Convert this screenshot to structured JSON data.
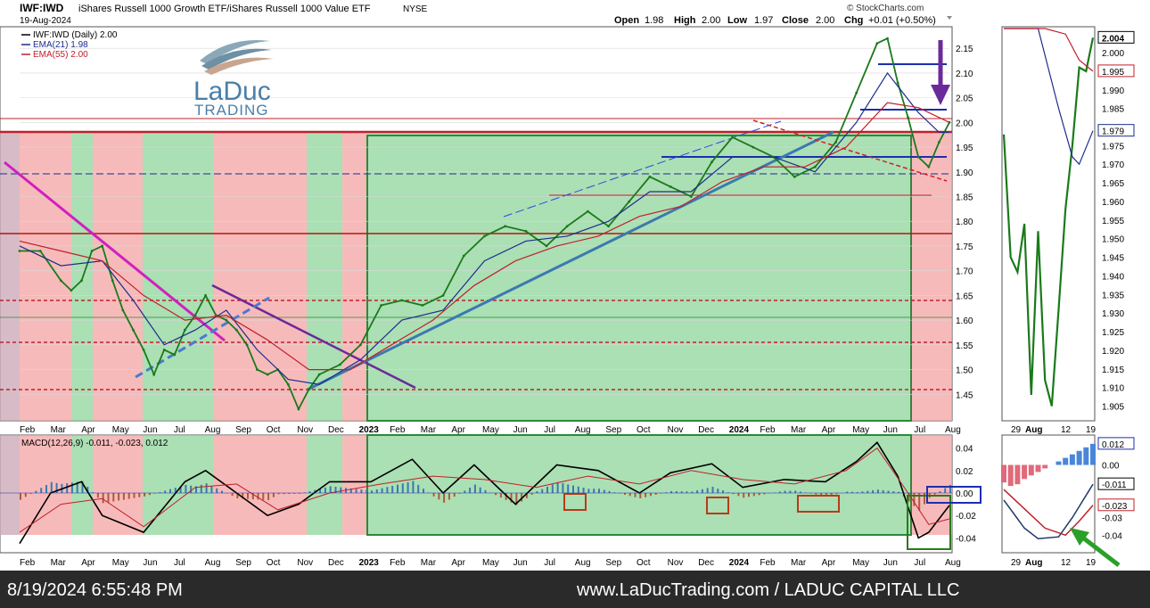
{
  "header": {
    "symbol": "IWF:IWD",
    "description": "iShares Russell 1000 Growth ETF/iShares Russell 1000 Value ETF",
    "exchange": "NYSE",
    "date": "19-Aug-2024",
    "watermark": "© StockCharts.com",
    "ohlc": {
      "open_label": "Open",
      "open": "1.98",
      "high_label": "High",
      "high": "2.00",
      "low_label": "Low",
      "low": "1.97",
      "close_label": "Close",
      "close": "2.00",
      "chg_label": "Chg",
      "chg": "+0.01 (+0.50%)"
    }
  },
  "legend": [
    {
      "text": "IWF:IWD (Daily) 2.00",
      "color": "#000000"
    },
    {
      "text": "EMA(21) 1.98",
      "color": "#1c2e8c"
    },
    {
      "text": "EMA(55) 2.00",
      "color": "#c0202a"
    }
  ],
  "logo": {
    "line1": "LaDuc",
    "line2": "TRADING"
  },
  "macd_label": "MACD(12,26,9) -0.011, -0.023, 0.012",
  "footer": {
    "timestamp": "8/19/2024 6:55:48 PM",
    "site": "www.LaDucTrading.com / LADUC CAPITAL LLC"
  },
  "colors": {
    "up": "#1a7a1a",
    "ema21": "#1c2e8c",
    "ema55": "#c0202a",
    "red_zone": "#f4a3a3",
    "green_zone": "#8fd49b",
    "magenta": "#d020c0",
    "purple": "#6a2a9a",
    "steelblue": "#3a7ab0",
    "green_arrow": "#2aa02a"
  },
  "chart_data": [
    {
      "type": "line",
      "title": "IWF:IWD (Daily) 2.00",
      "x_labels": [
        "Feb",
        "Mar",
        "Apr",
        "May",
        "Jun",
        "Jul",
        "Aug",
        "Sep",
        "Oct",
        "Nov",
        "Dec",
        "2023",
        "Feb",
        "Mar",
        "Apr",
        "May",
        "Jun",
        "Jul",
        "Aug",
        "Sep",
        "Oct",
        "Nov",
        "Dec",
        "2024",
        "Feb",
        "Mar",
        "Apr",
        "May",
        "Jun",
        "Jul",
        "Aug"
      ],
      "y_ticks": [
        "2.15",
        "2.10",
        "2.05",
        "2.00",
        "1.95",
        "1.90",
        "1.85",
        "1.80",
        "1.75",
        "1.70",
        "1.65",
        "1.60",
        "1.55",
        "1.50",
        "1.45"
      ],
      "ylim": [
        1.4,
        2.19
      ],
      "series": [
        {
          "name": "IWF:IWD (Daily) 2.00",
          "points": [
            [
              0,
              1.74
            ],
            [
              2,
              1.74
            ],
            [
              4,
              1.68
            ],
            [
              5,
              1.66
            ],
            [
              6,
              1.68
            ],
            [
              7,
              1.74
            ],
            [
              8,
              1.75
            ],
            [
              9,
              1.68
            ],
            [
              10,
              1.62
            ],
            [
              11,
              1.58
            ],
            [
              12,
              1.54
            ],
            [
              13,
              1.49
            ],
            [
              14,
              1.54
            ],
            [
              15,
              1.53
            ],
            [
              16,
              1.58
            ],
            [
              17,
              1.61
            ],
            [
              18,
              1.65
            ],
            [
              19,
              1.61
            ],
            [
              20,
              1.6
            ],
            [
              21,
              1.58
            ],
            [
              22,
              1.55
            ],
            [
              23,
              1.5
            ],
            [
              24,
              1.49
            ],
            [
              25,
              1.5
            ],
            [
              26,
              1.47
            ],
            [
              27,
              1.42
            ],
            [
              28,
              1.46
            ],
            [
              29,
              1.49
            ],
            [
              31,
              1.51
            ],
            [
              33,
              1.55
            ],
            [
              35,
              1.63
            ],
            [
              37,
              1.64
            ],
            [
              39,
              1.63
            ],
            [
              41,
              1.65
            ],
            [
              43,
              1.73
            ],
            [
              45,
              1.77
            ],
            [
              47,
              1.79
            ],
            [
              49,
              1.78
            ],
            [
              51,
              1.75
            ],
            [
              53,
              1.79
            ],
            [
              55,
              1.82
            ],
            [
              57,
              1.79
            ],
            [
              59,
              1.84
            ],
            [
              61,
              1.89
            ],
            [
              63,
              1.87
            ],
            [
              65,
              1.85
            ],
            [
              67,
              1.92
            ],
            [
              69,
              1.97
            ],
            [
              71,
              1.95
            ],
            [
              73,
              1.93
            ],
            [
              75,
              1.89
            ],
            [
              77,
              1.91
            ],
            [
              79,
              1.96
            ],
            [
              81,
              2.06
            ],
            [
              83,
              2.16
            ],
            [
              84,
              2.17
            ],
            [
              85,
              2.08
            ],
            [
              86,
              2.01
            ],
            [
              87,
              1.93
            ],
            [
              88,
              1.91
            ],
            [
              89,
              1.96
            ],
            [
              90,
              2.0
            ]
          ]
        },
        {
          "name": "EMA(21) 1.98",
          "points": [
            [
              0,
              1.75
            ],
            [
              4,
              1.71
            ],
            [
              8,
              1.72
            ],
            [
              11,
              1.64
            ],
            [
              14,
              1.55
            ],
            [
              17,
              1.58
            ],
            [
              20,
              1.62
            ],
            [
              23,
              1.54
            ],
            [
              26,
              1.48
            ],
            [
              29,
              1.47
            ],
            [
              33,
              1.52
            ],
            [
              37,
              1.6
            ],
            [
              41,
              1.62
            ],
            [
              45,
              1.72
            ],
            [
              49,
              1.76
            ],
            [
              53,
              1.77
            ],
            [
              57,
              1.8
            ],
            [
              61,
              1.86
            ],
            [
              65,
              1.86
            ],
            [
              69,
              1.93
            ],
            [
              73,
              1.93
            ],
            [
              77,
              1.9
            ],
            [
              81,
              2.0
            ],
            [
              84,
              2.1
            ],
            [
              87,
              2.02
            ],
            [
              89,
              1.98
            ],
            [
              90,
              1.98
            ]
          ]
        },
        {
          "name": "EMA(55) 2.00",
          "points": [
            [
              0,
              1.76
            ],
            [
              4,
              1.74
            ],
            [
              8,
              1.72
            ],
            [
              12,
              1.65
            ],
            [
              16,
              1.6
            ],
            [
              20,
              1.61
            ],
            [
              24,
              1.56
            ],
            [
              28,
              1.5
            ],
            [
              32,
              1.5
            ],
            [
              36,
              1.55
            ],
            [
              40,
              1.6
            ],
            [
              44,
              1.67
            ],
            [
              48,
              1.72
            ],
            [
              52,
              1.75
            ],
            [
              56,
              1.77
            ],
            [
              60,
              1.81
            ],
            [
              64,
              1.83
            ],
            [
              68,
              1.88
            ],
            [
              72,
              1.91
            ],
            [
              76,
              1.91
            ],
            [
              80,
              1.95
            ],
            [
              84,
              2.04
            ],
            [
              87,
              2.03
            ],
            [
              90,
              2.0
            ]
          ]
        }
      ]
    },
    {
      "type": "line",
      "title": "",
      "x_labels": [
        "29",
        "Aug",
        "12",
        "19"
      ],
      "y_ticks": [
        "2.004",
        "2.000",
        "1.995",
        "1.990",
        "1.985",
        "1.980",
        "1.979",
        "1.975",
        "1.970",
        "1.965",
        "1.960",
        "1.955",
        "1.950",
        "1.945",
        "1.940",
        "1.935",
        "1.930",
        "1.925",
        "1.920",
        "1.915",
        "1.910",
        "1.905"
      ],
      "ylim": [
        1.902,
        2.006
      ],
      "series": [
        {
          "name": "IWF:IWD",
          "points": [
            [
              0,
              1.978
            ],
            [
              1,
              1.945
            ],
            [
              2,
              1.941
            ],
            [
              3,
              1.954
            ],
            [
              4,
              1.908
            ],
            [
              5,
              1.952
            ],
            [
              6,
              1.912
            ],
            [
              7,
              1.905
            ],
            [
              8,
              1.931
            ],
            [
              9,
              1.958
            ],
            [
              10,
              1.975
            ],
            [
              11,
              1.996
            ],
            [
              12,
              1.995
            ],
            [
              13,
              2.004
            ]
          ]
        },
        {
          "name": "EMA(21)",
          "points": [
            [
              0,
              2.04
            ],
            [
              5,
              2.02
            ],
            [
              8,
              1.985
            ],
            [
              10,
              1.972
            ],
            [
              11,
              1.97
            ],
            [
              13,
              1.979
            ]
          ]
        },
        {
          "name": "EMA(55)",
          "points": [
            [
              0,
              2.02
            ],
            [
              6,
              2.015
            ],
            [
              9,
              2.005
            ],
            [
              11,
              1.998
            ],
            [
              13,
              1.995
            ]
          ]
        }
      ]
    },
    {
      "type": "line",
      "title": "MACD(12,26,9) -0.011, -0.023, 0.012",
      "y_ticks": [
        "0.04",
        "0.02",
        "0.00",
        "-0.02",
        "-0.04"
      ],
      "ylim": [
        -0.05,
        0.05
      ],
      "series": [
        {
          "name": "MACD",
          "points": [
            [
              0,
              -0.045
            ],
            [
              3,
              0.0
            ],
            [
              6,
              0.01
            ],
            [
              8,
              -0.02
            ],
            [
              12,
              -0.035
            ],
            [
              16,
              0.01
            ],
            [
              18,
              0.02
            ],
            [
              21,
              0.0
            ],
            [
              24,
              -0.02
            ],
            [
              27,
              -0.01
            ],
            [
              30,
              0.01
            ],
            [
              34,
              0.01
            ],
            [
              38,
              0.03
            ],
            [
              41,
              0.0
            ],
            [
              44,
              0.025
            ],
            [
              48,
              -0.01
            ],
            [
              52,
              0.025
            ],
            [
              56,
              0.02
            ],
            [
              60,
              0.0
            ],
            [
              63,
              0.018
            ],
            [
              67,
              0.026
            ],
            [
              70,
              0.005
            ],
            [
              74,
              0.012
            ],
            [
              78,
              0.01
            ],
            [
              81,
              0.028
            ],
            [
              83,
              0.045
            ],
            [
              85,
              0.015
            ],
            [
              87,
              -0.04
            ],
            [
              88,
              -0.035
            ],
            [
              90,
              -0.011
            ]
          ]
        },
        {
          "name": "Signal",
          "points": [
            [
              0,
              -0.035
            ],
            [
              4,
              -0.01
            ],
            [
              8,
              -0.005
            ],
            [
              12,
              -0.03
            ],
            [
              17,
              0.005
            ],
            [
              21,
              0.008
            ],
            [
              25,
              -0.015
            ],
            [
              30,
              0.0
            ],
            [
              35,
              0.008
            ],
            [
              40,
              0.015
            ],
            [
              45,
              0.012
            ],
            [
              50,
              0.005
            ],
            [
              55,
              0.015
            ],
            [
              60,
              0.008
            ],
            [
              65,
              0.02
            ],
            [
              70,
              0.012
            ],
            [
              75,
              0.008
            ],
            [
              80,
              0.02
            ],
            [
              83,
              0.04
            ],
            [
              86,
              0.0
            ],
            [
              88,
              -0.028
            ],
            [
              90,
              -0.023
            ]
          ]
        }
      ]
    },
    {
      "type": "line",
      "title": "",
      "x_labels": [
        "29",
        "Aug",
        "12",
        "19"
      ],
      "y_ticks": [
        "0.012",
        "0.00",
        "-0.011",
        "-0.023",
        "-0.03",
        "-0.04"
      ],
      "ylim": [
        -0.048,
        0.016
      ],
      "series": [
        {
          "name": "MACD",
          "points": [
            [
              0,
              -0.02
            ],
            [
              3,
              -0.036
            ],
            [
              5,
              -0.042
            ],
            [
              8,
              -0.041
            ],
            [
              10,
              -0.03
            ],
            [
              13,
              -0.011
            ]
          ]
        },
        {
          "name": "Signal",
          "points": [
            [
              0,
              -0.014
            ],
            [
              3,
              -0.025
            ],
            [
              6,
              -0.036
            ],
            [
              9,
              -0.04
            ],
            [
              11,
              -0.032
            ],
            [
              13,
              -0.023
            ]
          ]
        },
        {
          "name": "Histogram",
          "values": [
            -0.01,
            -0.012,
            -0.011,
            -0.008,
            -0.006,
            -0.004,
            -0.002,
            0.0,
            0.002,
            0.004,
            0.006,
            0.008,
            0.01,
            0.012
          ]
        }
      ]
    }
  ]
}
